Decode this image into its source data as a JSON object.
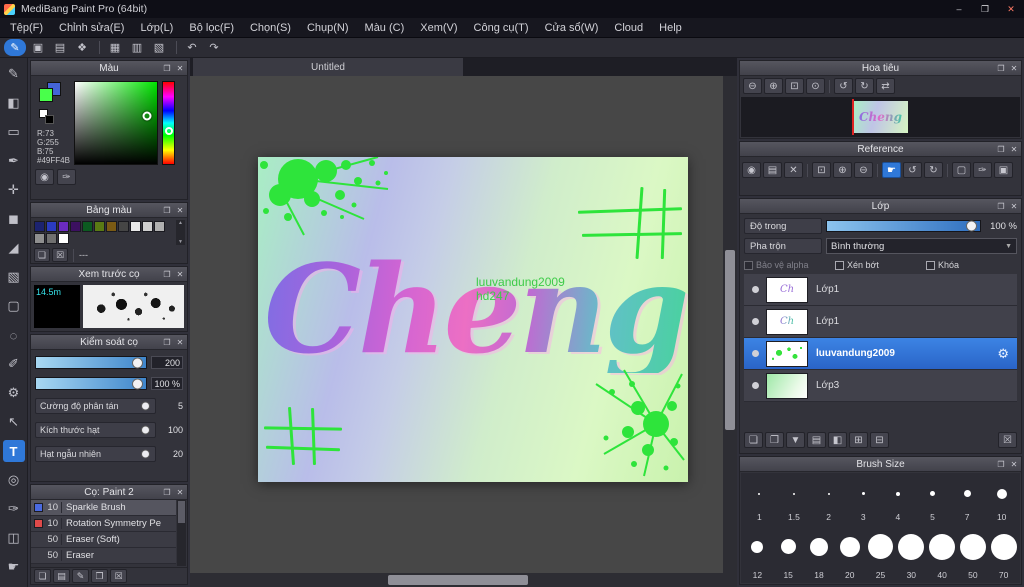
{
  "window": {
    "title": "MediBang Paint Pro (64bit)",
    "controls": {
      "minimize": "–",
      "maximize": "❐",
      "close": "✕"
    }
  },
  "icons": {
    "popout": "❐",
    "close": "✕",
    "dropdown_arrow": "▼",
    "scroll_up": "▲",
    "scroll_down": "▼",
    "gear": "⚙"
  },
  "menu": {
    "items": [
      "Tệp(F)",
      "Chỉnh sửa(E)",
      "Lớp(L)",
      "Bộ lọc(F)",
      "Chọn(S)",
      "Chụp(N)",
      "Màu (C)",
      "Xem(V)",
      "Công cụ(T)",
      "Cửa sổ(W)",
      "Cloud",
      "Help"
    ]
  },
  "toolbar": {
    "buttons": [
      {
        "name": "pen-mode-button",
        "glyph": "✎",
        "accent": true
      },
      {
        "name": "save-button",
        "glyph": "▣"
      },
      {
        "name": "palette-view-button",
        "glyph": "▤"
      },
      {
        "name": "color-pair-button",
        "glyph": "❖"
      },
      {
        "sep": true
      },
      {
        "name": "grid-toggle-button",
        "glyph": "▦"
      },
      {
        "name": "snap-parallel-button",
        "glyph": "▥"
      },
      {
        "name": "snap-grid-button",
        "glyph": "▧"
      },
      {
        "sep": true
      },
      {
        "name": "undo-button",
        "glyph": "↶"
      },
      {
        "name": "redo-button",
        "glyph": "↷"
      }
    ]
  },
  "toolstrip": {
    "tools": [
      {
        "name": "brush-tool",
        "glyph": "✎"
      },
      {
        "name": "eraser-tool",
        "glyph": "◧"
      },
      {
        "name": "shape-brush-tool",
        "glyph": "▭"
      },
      {
        "name": "dot-pen-tool",
        "glyph": "✒"
      },
      {
        "name": "move-tool",
        "glyph": "✛"
      },
      {
        "name": "fill-rect-tool",
        "glyph": "◼"
      },
      {
        "name": "bucket-tool",
        "glyph": "◢"
      },
      {
        "name": "gradient-tool",
        "glyph": "▧"
      },
      {
        "name": "select-rect-tool",
        "glyph": "▢"
      },
      {
        "name": "lasso-tool",
        "glyph": "◌"
      },
      {
        "name": "select-pen-tool",
        "glyph": "✐"
      },
      {
        "name": "operation-tool",
        "glyph": "⚙"
      },
      {
        "name": "cursor-tool",
        "glyph": "↖"
      },
      {
        "name": "text-tool",
        "glyph": "T",
        "selected": true
      },
      {
        "name": "zoom-tool",
        "glyph": "◎"
      },
      {
        "name": "stylus-tool",
        "glyph": "✑"
      },
      {
        "name": "slice-tool",
        "glyph": "◫"
      },
      {
        "name": "hand-tool",
        "glyph": "☛"
      }
    ]
  },
  "canvas": {
    "tab": "Untitled",
    "artwork": {
      "title_text": "Cheng",
      "watermark_line1": "luuvandung2009",
      "watermark_line2": "hd247"
    }
  },
  "panels": {
    "color": {
      "title": "Màu",
      "r": "R:73",
      "g": "G:255",
      "b": "B:75",
      "hex": "#49FF4B",
      "buttons": [
        {
          "name": "color-wheel-button",
          "glyph": "◉"
        },
        {
          "name": "eyedropper-button",
          "glyph": "✑"
        }
      ]
    },
    "palette": {
      "title": "Bảng màu",
      "label": "---",
      "swatches": [
        "#1c2370",
        "#2b3bc0",
        "#6b2bc0",
        "#3c1060",
        "#0c5a20",
        "#5a7a14",
        "#7a5a14",
        "#454545",
        "#e8e8e8",
        "#cfcfcf",
        "#b0b0b0",
        "#8f8f8f",
        "#707070",
        "#ffffff"
      ],
      "buttons": [
        {
          "name": "add-color-button",
          "glyph": "❏"
        },
        {
          "name": "delete-color-button",
          "glyph": "☒"
        }
      ]
    },
    "brush_preview": {
      "title": "Xem trước cọ",
      "size_label": "14.5m"
    },
    "brush_control": {
      "title": "Kiểm soát cọ",
      "size_value": "200",
      "opacity_value": "100 %",
      "sliders": [
        {
          "label": "Cường độ phân tán",
          "value": "5"
        },
        {
          "label": "Kích thước hạt",
          "value": "100"
        },
        {
          "label": "Hạt ngẫu nhiên",
          "value": "20"
        }
      ]
    },
    "brush_list": {
      "title": "Cọ: Paint 2",
      "items": [
        {
          "size": "10",
          "name": "Sparkle Brush",
          "chip": "#4a6ae0",
          "selected": true
        },
        {
          "size": "10",
          "name": "Rotation Symmetry Pe",
          "chip": "#e04a4a"
        },
        {
          "size": "50",
          "name": "Eraser (Soft)",
          "chip": ""
        },
        {
          "size": "50",
          "name": "Eraser",
          "chip": ""
        }
      ],
      "buttons": [
        {
          "name": "add-brush-button",
          "glyph": "❏"
        },
        {
          "name": "brush-folder-button",
          "glyph": "▤"
        },
        {
          "name": "edit-brush-button",
          "glyph": "✎"
        },
        {
          "name": "duplicate-brush-button",
          "glyph": "❐"
        },
        {
          "name": "delete-brush-button",
          "glyph": "☒"
        }
      ]
    },
    "navigator": {
      "title": "Hoa tiêu",
      "buttons": [
        {
          "name": "nav-zoom-out-button",
          "glyph": "⊖"
        },
        {
          "name": "nav-zoom-in-button",
          "glyph": "⊕"
        },
        {
          "name": "nav-fit-button",
          "glyph": "⊡"
        },
        {
          "name": "nav-actual-size-button",
          "glyph": "⊙"
        },
        {
          "sep": true
        },
        {
          "name": "nav-rotate-left-button",
          "glyph": "↺"
        },
        {
          "name": "nav-rotate-right-button",
          "glyph": "↻"
        },
        {
          "name": "nav-reset-button",
          "glyph": "⇄"
        }
      ]
    },
    "reference": {
      "title": "Reference",
      "buttons": [
        {
          "name": "ref-show-button",
          "glyph": "◉"
        },
        {
          "name": "ref-open-button",
          "glyph": "▤"
        },
        {
          "name": "ref-clear-button",
          "glyph": "✕"
        },
        {
          "sep": true
        },
        {
          "name": "ref-fit-button",
          "glyph": "⊡"
        },
        {
          "name": "ref-zoom-in-button",
          "glyph": "⊕"
        },
        {
          "name": "ref-zoom-out-button",
          "glyph": "⊖"
        },
        {
          "sep": true
        },
        {
          "name": "ref-hand-button",
          "glyph": "☛",
          "selected": true
        },
        {
          "name": "ref-rotate-left-button",
          "glyph": "↺"
        },
        {
          "name": "ref-rotate-right-button",
          "glyph": "↻"
        },
        {
          "sep": true
        },
        {
          "name": "ref-crop-button",
          "glyph": "▢"
        },
        {
          "name": "ref-eyedropper-button",
          "glyph": "✑"
        },
        {
          "name": "ref-grid-button",
          "glyph": "▣"
        }
      ]
    },
    "layers": {
      "title": "Lớp",
      "opacity_label": "Độ trong",
      "opacity_value": "100 %",
      "blend_label": "Pha trộn",
      "blend_value": "Bình thường",
      "checkboxes": [
        "Bảo vệ alpha",
        "Xén bớt",
        "Khóa"
      ],
      "items": [
        {
          "name": "Lớp1",
          "thumb": "text-purple",
          "thumb_label": "Ch"
        },
        {
          "name": "Lớp1",
          "thumb": "text-multi",
          "thumb_label": "Ch"
        },
        {
          "name": "luuvandung2009",
          "thumb": "splatter",
          "selected": true
        },
        {
          "name": "Lớp3",
          "thumb": "gradient"
        }
      ],
      "buttons": [
        {
          "name": "new-layer-button",
          "glyph": "❏"
        },
        {
          "name": "duplicate-layer-button",
          "glyph": "❐"
        },
        {
          "name": "merge-down-button",
          "glyph": "▼"
        },
        {
          "name": "new-folder-button",
          "glyph": "▤"
        },
        {
          "name": "layer-mask-button",
          "glyph": "◧"
        },
        {
          "name": "add-group-button",
          "glyph": "⊞"
        },
        {
          "name": "flatten-button",
          "glyph": "⊟"
        },
        {
          "spacer": true
        },
        {
          "name": "delete-layer-button",
          "glyph": "☒"
        }
      ]
    },
    "brush_size": {
      "title": "Brush Size",
      "rows": [
        [
          1,
          1.5,
          2,
          3,
          4,
          5,
          7,
          10
        ],
        [
          12,
          15,
          18,
          20,
          25,
          30,
          40,
          50,
          70
        ]
      ]
    }
  }
}
